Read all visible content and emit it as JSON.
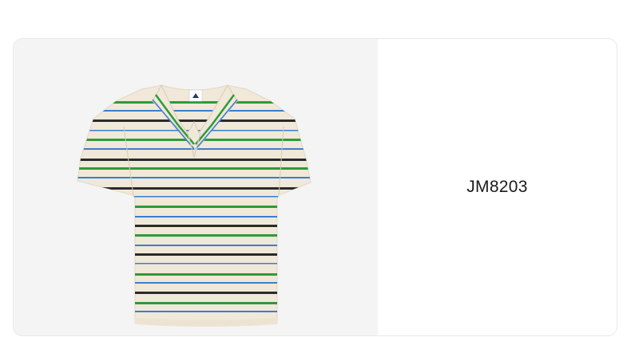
{
  "product": {
    "sku": "JM8203",
    "image": {
      "icon": "striped-polo-shirt-image",
      "brand_mark": "adidas-trefoil-logo",
      "colors": {
        "base": "#f0e8d8",
        "black": "#2a2a2a",
        "blue": "#3a7ecf",
        "green": "#2e9a3a"
      }
    }
  }
}
